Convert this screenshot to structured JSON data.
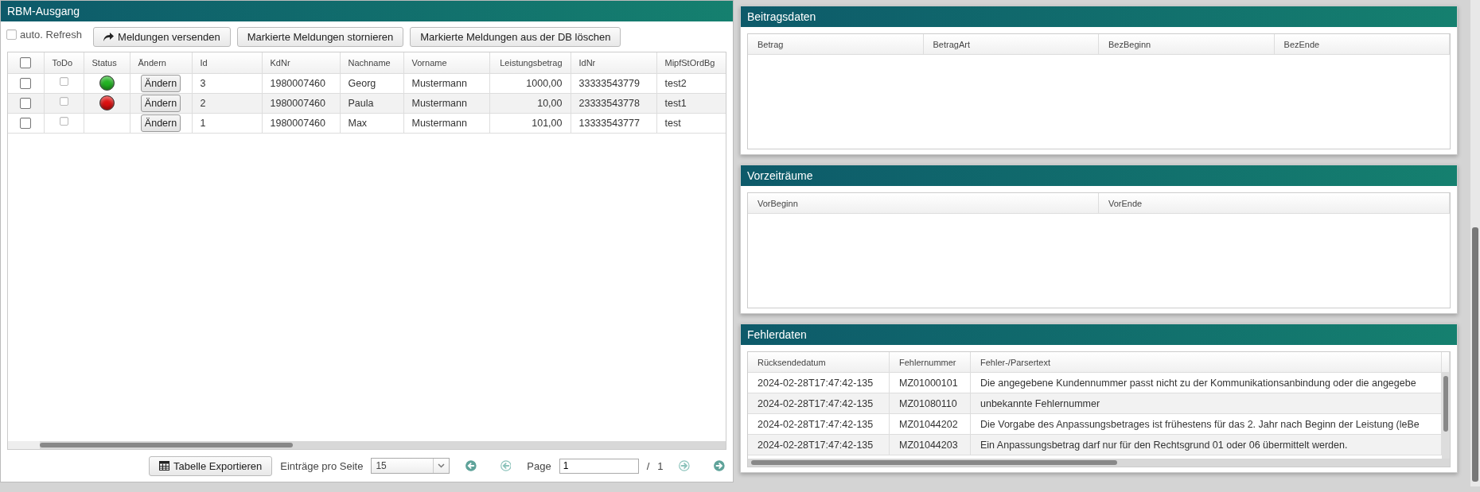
{
  "left_panel": {
    "title": "RBM-Ausgang",
    "auto_refresh": {
      "label": "auto. Refresh",
      "checked": false
    },
    "toolbar_buttons": [
      {
        "label": "Meldungen versenden",
        "kind": "share"
      },
      {
        "label": "Markierte Meldungen stornieren",
        "kind": "plain"
      },
      {
        "label": "Markierte Meldungen aus der DB löschen",
        "kind": "plain"
      }
    ],
    "table": {
      "all_checked": false,
      "columns": [
        "ToDo",
        "Status",
        "Ändern",
        "Id",
        "KdNr",
        "Nachname",
        "Vorname",
        "Leistungsbetrag",
        "IdNr",
        "MipfStOrdBg"
      ],
      "rows": [
        {
          "checked": false,
          "cells": [
            {
              "kind": "checkbox",
              "checked": false
            },
            {
              "kind": "status",
              "color": "#22b322"
            },
            {
              "kind": "button",
              "text": "Ändern"
            },
            {
              "kind": "text",
              "text": "3"
            },
            {
              "kind": "text",
              "text": "1980007460"
            },
            {
              "kind": "text",
              "text": "Georg"
            },
            {
              "kind": "text",
              "text": "Mustermann"
            },
            {
              "kind": "amount",
              "text": "1000,00"
            },
            {
              "kind": "text",
              "text": "33333543779"
            },
            {
              "kind": "text",
              "text": "test2"
            }
          ]
        },
        {
          "checked": false,
          "cells": [
            {
              "kind": "checkbox",
              "checked": false
            },
            {
              "kind": "status",
              "color": "#dd1111"
            },
            {
              "kind": "button",
              "text": "Ändern"
            },
            {
              "kind": "text",
              "text": "2"
            },
            {
              "kind": "text",
              "text": "1980007460"
            },
            {
              "kind": "text",
              "text": "Paula"
            },
            {
              "kind": "text",
              "text": "Mustermann"
            },
            {
              "kind": "amount",
              "text": "10,00"
            },
            {
              "kind": "text",
              "text": "23333543778"
            },
            {
              "kind": "text",
              "text": "test1"
            }
          ]
        },
        {
          "checked": false,
          "cells": [
            {
              "kind": "checkbox",
              "checked": false
            },
            {
              "kind": "empty"
            },
            {
              "kind": "button",
              "text": "Ändern"
            },
            {
              "kind": "text",
              "text": "1"
            },
            {
              "kind": "text",
              "text": "1980007460"
            },
            {
              "kind": "text",
              "text": "Max"
            },
            {
              "kind": "text",
              "text": "Mustermann"
            },
            {
              "kind": "amount",
              "text": "101,00"
            },
            {
              "kind": "text",
              "text": "13333543777"
            },
            {
              "kind": "text",
              "text": "test"
            }
          ]
        }
      ]
    },
    "footer": {
      "export_button": "Tabelle Exportieren",
      "page_size_label": "Einträge pro Seite",
      "page_size": "15",
      "page_label": "Page",
      "page": "1",
      "page_separator": "/",
      "page_count": "1",
      "pager_buttons": [
        {
          "kind": "first",
          "disabled": false
        },
        {
          "kind": "previous",
          "disabled": true
        },
        {
          "kind": "next",
          "disabled": true
        },
        {
          "kind": "last",
          "disabled": false
        }
      ]
    }
  },
  "sections": [
    {
      "title": "Beitragsdaten",
      "columns": [
        "Betrag",
        "BetragArt",
        "BezBeginn",
        "BezEnde"
      ]
    },
    {
      "title": "Vorzeiträume",
      "columns": [
        "VorBeginn",
        "VorEnde"
      ]
    },
    {
      "title": "Fehlerdaten",
      "columns": [
        "Rücksendedatum",
        "Fehlernummer",
        "Fehler-/Parsertext"
      ],
      "rows": [
        [
          "2024-02-28T17:47:42-135",
          "MZ01000101",
          "Die angegebene Kundennummer passt nicht zu der Kommunikationsanbindung oder die angegebe"
        ],
        [
          "2024-02-28T17:47:42-135",
          "MZ01080110",
          "unbekannte Fehlernummer"
        ],
        [
          "2024-02-28T17:47:42-135",
          "MZ01044202",
          "Die Vorgabe des Anpassungsbetrages ist frühestens für das 2. Jahr nach Beginn der Leistung (leBe"
        ],
        [
          "2024-02-28T17:47:42-135",
          "MZ01044203",
          "Ein Anpassungsbetrag darf nur für den Rechtsgrund 01 oder 06 übermittelt werden."
        ]
      ]
    }
  ]
}
